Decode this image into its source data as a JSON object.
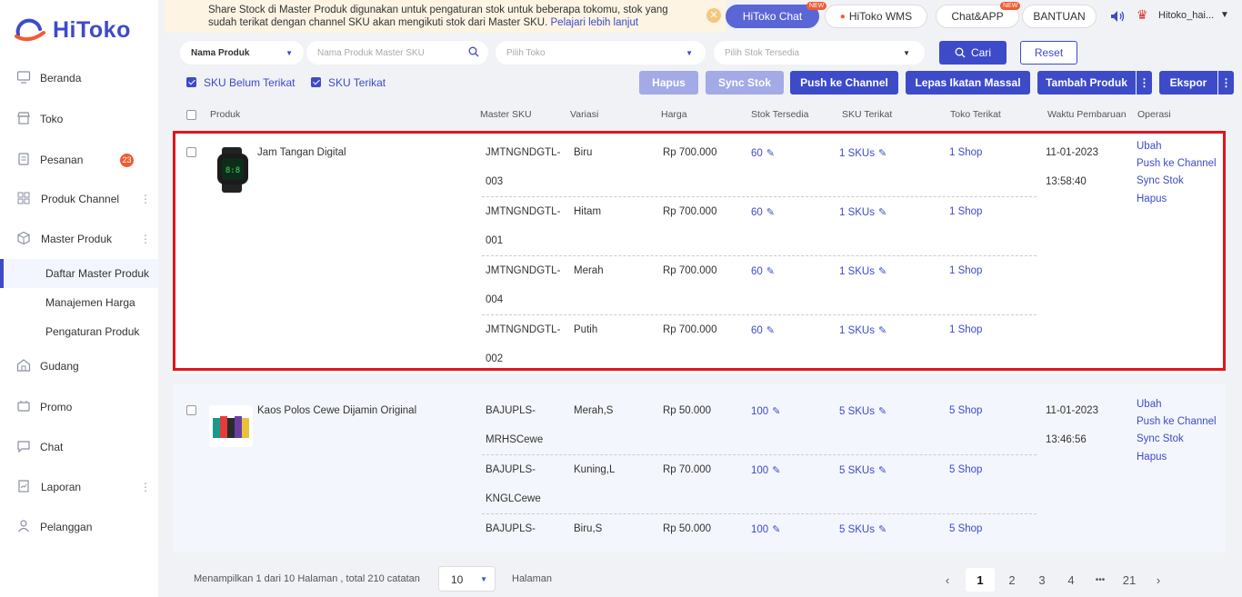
{
  "brand": {
    "name": "HiToko"
  },
  "sidebar": {
    "items": [
      {
        "label": "Beranda",
        "icon": "monitor-icon"
      },
      {
        "label": "Toko",
        "icon": "store-icon"
      },
      {
        "label": "Pesanan",
        "icon": "order-icon",
        "badge": "23"
      },
      {
        "label": "Produk Channel",
        "icon": "grid-icon"
      },
      {
        "label": "Master Produk",
        "icon": "box-icon"
      },
      {
        "label": "Gudang",
        "icon": "warehouse-icon"
      },
      {
        "label": "Promo",
        "icon": "promo-icon"
      },
      {
        "label": "Chat",
        "icon": "chat-icon"
      },
      {
        "label": "Laporan",
        "icon": "report-icon"
      },
      {
        "label": "Pelanggan",
        "icon": "user-icon"
      }
    ],
    "subitems": [
      "Daftar Master Produk",
      "Manajemen Harga",
      "Pengaturan Produk"
    ]
  },
  "topbar": {
    "notice": "Share Stock di Master Produk digunakan untuk pengaturan stok untuk beberapa tokomu, stok yang sudah terikat dengan channel SKU akan mengikuti stok dari Master SKU.",
    "notice_link": "Pelajari lebih lanjut",
    "hitoko_chat": "HiToko Chat",
    "hitoko_wms": "HiToko WMS",
    "chat_app": "Chat&APP",
    "bantuan": "BANTUAN",
    "new_tag": "NEW",
    "user": "Hitoko_hai..."
  },
  "filters": {
    "field_select": "Nama Produk",
    "search_placeholder": "Nama Produk Master SKU",
    "store_placeholder": "Pilih Toko",
    "stock_placeholder": "Pilih Stok Tersedia",
    "search_btn": "Cari",
    "reset_btn": "Reset",
    "chk_unbound": "SKU Belum Terikat",
    "chk_bound": "SKU Terikat"
  },
  "actions": {
    "hapus": "Hapus",
    "sync": "Sync Stok",
    "push": "Push ke Channel",
    "lepas": "Lepas Ikatan Massal",
    "tambah": "Tambah Produk",
    "ekspor": "Ekspor"
  },
  "table": {
    "headers": {
      "produk": "Produk",
      "master_sku": "Master SKU",
      "variasi": "Variasi",
      "harga": "Harga",
      "stok": "Stok Tersedia",
      "sku": "SKU Terikat",
      "toko": "Toko Terikat",
      "waktu": "Waktu Pembaruan",
      "operasi": "Operasi"
    },
    "products": [
      {
        "name": "Jam Tangan Digital",
        "date": "11-01-2023",
        "time": "13:58:40",
        "ops": [
          "Ubah",
          "Push ke Channel",
          "Sync Stok",
          "Hapus"
        ],
        "variants": [
          {
            "sku1": "JMTNGNDGTL-",
            "sku2": "003",
            "var": "Biru",
            "price": "Rp 700.000",
            "stock": "60",
            "skus": "1 SKUs",
            "shop": "1 Shop"
          },
          {
            "sku1": "JMTNGNDGTL-",
            "sku2": "001",
            "var": "Hitam",
            "price": "Rp 700.000",
            "stock": "60",
            "skus": "1 SKUs",
            "shop": "1 Shop"
          },
          {
            "sku1": "JMTNGNDGTL-",
            "sku2": "004",
            "var": "Merah",
            "price": "Rp 700.000",
            "stock": "60",
            "skus": "1 SKUs",
            "shop": "1 Shop"
          },
          {
            "sku1": "JMTNGNDGTL-",
            "sku2": "002",
            "var": "Putih",
            "price": "Rp 700.000",
            "stock": "60",
            "skus": "1 SKUs",
            "shop": "1 Shop"
          }
        ]
      },
      {
        "name": "Kaos Polos Cewe Dijamin Original",
        "date": "11-01-2023",
        "time": "13:46:56",
        "ops": [
          "Ubah",
          "Push ke Channel",
          "Sync Stok",
          "Hapus"
        ],
        "variants": [
          {
            "sku1": "BAJUPLS-",
            "sku2": "MRHSCewe",
            "var": "Merah,S",
            "price": "Rp 50.000",
            "stock": "100",
            "skus": "5 SKUs",
            "shop": "5 Shop"
          },
          {
            "sku1": "BAJUPLS-",
            "sku2": "KNGLCewe",
            "var": "Kuning,L",
            "price": "Rp 70.000",
            "stock": "100",
            "skus": "5 SKUs",
            "shop": "5 Shop"
          },
          {
            "sku1": "BAJUPLS-",
            "sku2": "",
            "var": "Biru,S",
            "price": "Rp 50.000",
            "stock": "100",
            "skus": "5 SKUs",
            "shop": "5 Shop"
          }
        ]
      }
    ]
  },
  "pagination": {
    "summary": "Menampilkan 1 dari 10 Halaman , total 210 catatan",
    "page_size": "10",
    "halaman": "Halaman",
    "pages": [
      "1",
      "2",
      "3",
      "4",
      "•••",
      "21"
    ],
    "current": "1"
  },
  "colors": {
    "primary": "#3d4bc9",
    "highlight": "#e3141b",
    "badge": "#f25b32"
  }
}
